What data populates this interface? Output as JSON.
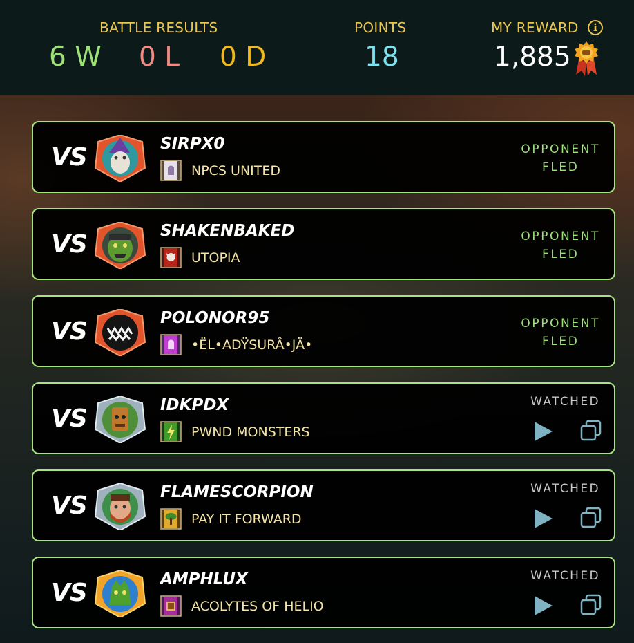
{
  "header": {
    "battle_results_label": "BATTLE RESULTS",
    "wins": "6 W",
    "losses": "0 L",
    "draws": "0 D",
    "points_label": "POINTS",
    "points": "18",
    "reward_label": "MY REWARD",
    "reward": "1,885",
    "icons": {
      "info": "info-icon",
      "reward": "medal-icon"
    }
  },
  "colors": {
    "wins": "#9ee07a",
    "losses": "#f08a84",
    "draws": "#f2b820",
    "points": "#7fe3ef",
    "label": "#e9c650",
    "card_border": "#a7e37e"
  },
  "battles": [
    {
      "vs": "VS",
      "player": "SIRPX0",
      "guild": "NPCS UNITED",
      "status_line1": "OPPONENT",
      "status_line2": "FLED"
    },
    {
      "vs": "VS",
      "player": "SHAKENBAKED",
      "guild": "UTOPIA",
      "status_line1": "OPPONENT",
      "status_line2": "FLED"
    },
    {
      "vs": "VS",
      "player": "POLONOR95",
      "guild": "•ËL•ADŸSURÂ•JÄ•",
      "status_line1": "OPPONENT",
      "status_line2": "FLED"
    },
    {
      "vs": "VS",
      "player": "IDKPDX",
      "guild": "PWND MONSTERS",
      "status_line1": "WATCHED"
    },
    {
      "vs": "VS",
      "player": "FLAMESCORPION",
      "guild": "PAY IT FORWARD",
      "status_line1": "WATCHED"
    },
    {
      "vs": "VS",
      "player": "AMPHLUX",
      "guild": "ACOLYTES OF HELIO",
      "status_line1": "WATCHED"
    }
  ]
}
